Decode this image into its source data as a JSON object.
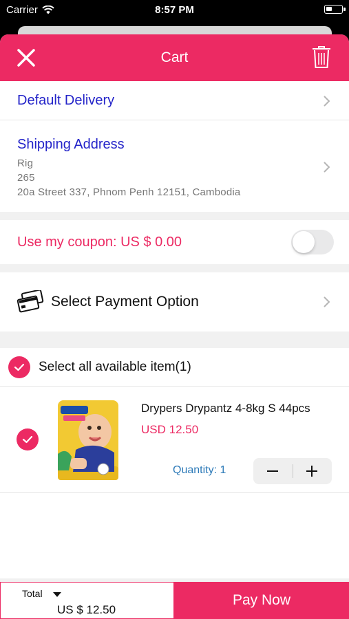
{
  "status_bar": {
    "carrier": "Carrier",
    "time": "8:57 PM"
  },
  "header": {
    "title": "Cart",
    "close_icon": "close-icon",
    "trash_icon": "trash-icon"
  },
  "delivery": {
    "label": "Default Delivery"
  },
  "shipping": {
    "label": "Shipping Address",
    "name": "Rig",
    "phone": "265",
    "address": "20a Street 337, Phnom Penh 12151, Cambodia"
  },
  "coupon": {
    "label": "Use my coupon: US $ 0.00",
    "enabled": false
  },
  "payment": {
    "label": "Select Payment Option",
    "icon": "payment-card-icon"
  },
  "select_all": {
    "label": "Select all available item(1)",
    "checked": true
  },
  "items": [
    {
      "name": "Drypers Drypantz 4-8kg S 44pcs",
      "price": "USD 12.50",
      "quantity_label": "Quantity: 1",
      "checked": true
    }
  ],
  "footer": {
    "total_label": "Total",
    "total_value": "US $ 12.50",
    "pay_label": "Pay Now"
  },
  "colors": {
    "accent": "#ec2a63",
    "link_blue": "#2424c9",
    "quantity_blue": "#2d7ab8"
  }
}
